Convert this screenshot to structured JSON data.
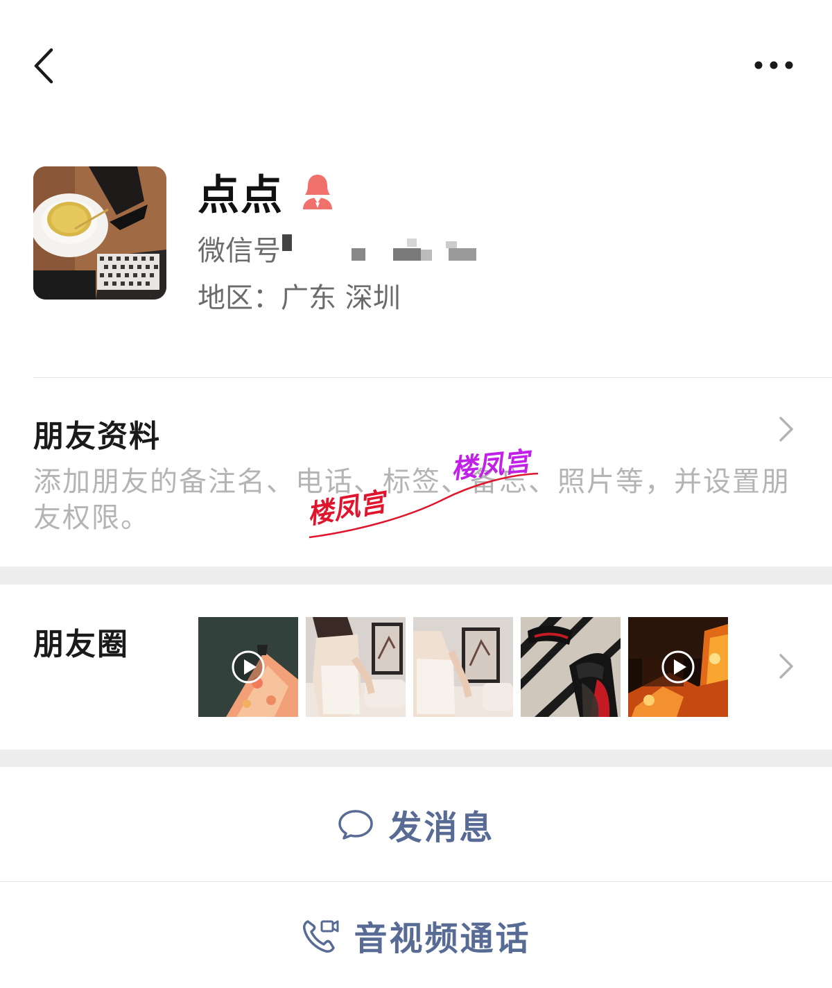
{
  "header": {
    "back_icon": "chevron-left-icon",
    "more_icon": "more-horizontal-icon"
  },
  "profile": {
    "nickname": "点点",
    "gender_icon": "female-user-icon",
    "gender_color": "#f0706b",
    "wechat_id_label": "微信号",
    "region_label": "地区：",
    "region_value": "广东 深圳"
  },
  "friend_info": {
    "title": "朋友资料",
    "description": "添加朋友的备注名、电话、标签、备忘、照片等，并设置朋友权限。"
  },
  "moments": {
    "title": "朋友圈",
    "thumbnails": [
      {
        "id": "thumb-1",
        "is_video": true
      },
      {
        "id": "thumb-2",
        "is_video": false
      },
      {
        "id": "thumb-3",
        "is_video": false
      },
      {
        "id": "thumb-4",
        "is_video": false
      },
      {
        "id": "thumb-5",
        "is_video": true
      }
    ]
  },
  "actions": {
    "send_message": "发消息",
    "av_call": "音视频通话",
    "accent_color": "#576b95"
  },
  "watermarks": {
    "primary": "楼凤宫",
    "secondary": "楼凤宫",
    "primary_color": "#e0142c",
    "secondary_color": "#c020e8"
  }
}
